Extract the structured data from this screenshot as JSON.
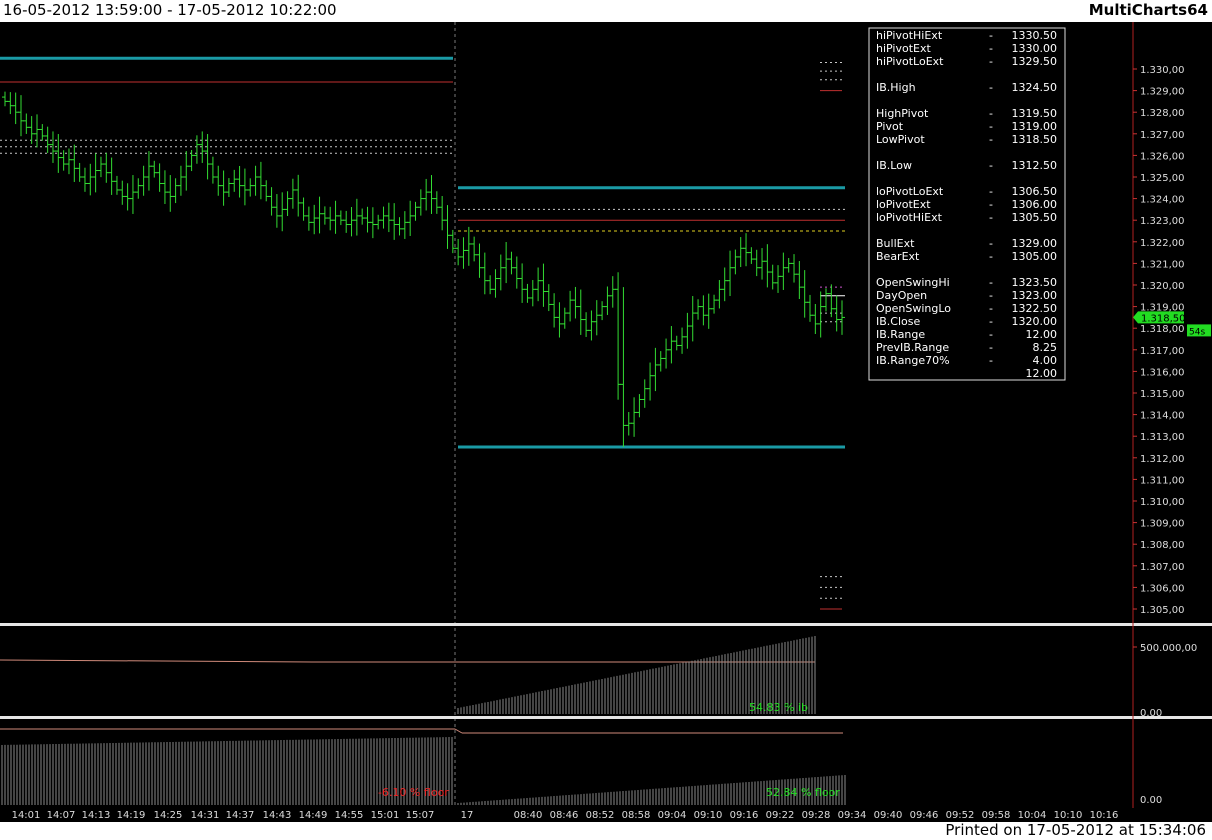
{
  "window": {
    "title_range": "16-05-2012 13:59:00 - 17-05-2012 10:22:00",
    "app_name": "MultiCharts64",
    "printed_on": "Printed on 17-05-2012 at 15:34:06"
  },
  "colors": {
    "background": "#000000",
    "bars": "#33dd33",
    "teal_levels": "#1a9aa5",
    "dashed_pivot": "#c8c8c8",
    "red_lines": "#c03030",
    "yellow_lines": "#e0d020",
    "volume_bars": "#8a8a8a",
    "axis_line": "#b02020",
    "last_price_tag": "#22dd22",
    "text_green": "#22dd22",
    "text_red": "#ee2222"
  },
  "chart_data": {
    "type": "bar",
    "title": "",
    "x_ticks": [
      "14:01",
      "14:07",
      "14:13",
      "14:19",
      "14:25",
      "14:31",
      "14:37",
      "14:43",
      "14:49",
      "14:55",
      "15:01",
      "15:07",
      "17",
      "08:40",
      "08:46",
      "08:52",
      "08:58",
      "09:04",
      "09:10",
      "09:16",
      "09:22",
      "09:28",
      "09:34",
      "09:40",
      "09:46",
      "09:52",
      "09:58",
      "10:04",
      "10:10",
      "10:16"
    ],
    "y_ticks": [
      "1.330,00",
      "1.329,00",
      "1.328,00",
      "1.327,00",
      "1.326,00",
      "1.325,00",
      "1.324,00",
      "1.323,00",
      "1.322,00",
      "1.321,00",
      "1.320,00",
      "1.319,00",
      "1.318,00",
      "1.317,00",
      "1.316,00",
      "1.315,00",
      "1.314,00",
      "1.313,00",
      "1.312,00",
      "1.311,00",
      "1.310,00",
      "1.309,00",
      "1.308,00",
      "1.307,00",
      "1.306,00",
      "1.305,00"
    ],
    "ylim": [
      1304.6,
      1330.8
    ],
    "close_path": [
      1328.5,
      1328.3,
      1328.0,
      1327.6,
      1327.3,
      1327.0,
      1327.2,
      1326.9,
      1326.5,
      1326.2,
      1325.9,
      1325.6,
      1325.8,
      1325.4,
      1325.0,
      1324.7,
      1325.0,
      1325.3,
      1325.6,
      1325.2,
      1324.8,
      1324.4,
      1324.1,
      1324.0,
      1324.3,
      1324.6,
      1325.0,
      1325.5,
      1325.2,
      1324.7,
      1324.3,
      1324.1,
      1324.6,
      1325.0,
      1325.5,
      1326.0,
      1326.5,
      1326.2,
      1325.6,
      1325.0,
      1324.6,
      1324.3,
      1324.7,
      1324.9,
      1324.6,
      1324.4,
      1324.6,
      1325.0,
      1324.6,
      1324.1,
      1323.6,
      1323.2,
      1323.5,
      1324.0,
      1324.4,
      1323.8,
      1323.2,
      1322.9,
      1323.1,
      1323.3,
      1323.1,
      1323.0,
      1323.2,
      1323.0,
      1322.8,
      1323.0,
      1323.2,
      1323.1,
      1322.9,
      1322.8,
      1323.0,
      1323.2,
      1323.0,
      1322.8,
      1322.6,
      1322.9,
      1323.2,
      1323.6,
      1324.0,
      1324.3,
      1324.0,
      1323.6,
      1323.0,
      1322.3,
      1321.7,
      1321.3,
      1321.6,
      1321.9,
      1321.4,
      1320.8,
      1320.2,
      1319.8,
      1320.3,
      1320.8,
      1321.2,
      1320.8,
      1320.3,
      1319.8,
      1319.4,
      1319.8,
      1320.2,
      1319.7,
      1319.1,
      1318.5,
      1318.2,
      1318.7,
      1319.3,
      1319.0,
      1318.4,
      1317.9,
      1318.3,
      1318.6,
      1319.0,
      1319.5,
      1319.8,
      1315.4,
      1313.5,
      1313.6,
      1314.1,
      1314.7,
      1315.2,
      1315.8,
      1316.3,
      1316.6,
      1317.0,
      1317.4,
      1317.2,
      1317.6,
      1318.1,
      1318.7,
      1319.0,
      1318.6,
      1318.9,
      1319.3,
      1319.8,
      1320.2,
      1320.8,
      1321.3,
      1321.7,
      1321.5,
      1321.2,
      1320.8,
      1321.1,
      1320.6,
      1320.1,
      1320.4,
      1320.8,
      1321.0,
      1320.5,
      1319.9,
      1319.2,
      1318.6,
      1318.2,
      1319.0,
      1319.6,
      1318.9,
      1318.4,
      1318.5
    ]
  },
  "reference_lines": [
    {
      "name": "hiPivotHiExt",
      "value": 1330.5
    },
    {
      "name": "IB.High prev",
      "value": 1329.4
    },
    {
      "name": "pivot-high-prev",
      "value": 1326.7
    },
    {
      "name": "pivot-prev",
      "value": 1326.4
    },
    {
      "name": "pivot-low-prev",
      "value": 1326.1
    },
    {
      "name": "IB.High",
      "value": 1324.5
    },
    {
      "name": "IB.Low",
      "value": 1312.5
    },
    {
      "name": "OpenSwingHi",
      "value": 1323.5
    },
    {
      "name": "DayOpen",
      "value": 1323.0
    },
    {
      "name": "OpenSwingLo",
      "value": 1322.5
    }
  ],
  "stats_table": [
    {
      "label": "hiPivotHiExt",
      "sep": "-",
      "value": "1330.50"
    },
    {
      "label": "hiPivotExt",
      "sep": "-",
      "value": "1330.00"
    },
    {
      "label": "hiPivotLoExt",
      "sep": "-",
      "value": "1329.50"
    },
    {
      "label": "",
      "sep": "",
      "value": ""
    },
    {
      "label": "IB.High",
      "sep": "-",
      "value": "1324.50"
    },
    {
      "label": "",
      "sep": "",
      "value": ""
    },
    {
      "label": "HighPivot",
      "sep": "-",
      "value": "1319.50"
    },
    {
      "label": "Pivot",
      "sep": "-",
      "value": "1319.00"
    },
    {
      "label": "LowPivot",
      "sep": "-",
      "value": "1318.50"
    },
    {
      "label": "",
      "sep": "",
      "value": ""
    },
    {
      "label": "IB.Low",
      "sep": "-",
      "value": "1312.50"
    },
    {
      "label": "",
      "sep": "",
      "value": ""
    },
    {
      "label": "loPivotLoExt",
      "sep": "-",
      "value": "1306.50"
    },
    {
      "label": "loPivotExt",
      "sep": "-",
      "value": "1306.00"
    },
    {
      "label": "loPivotHiExt",
      "sep": "-",
      "value": "1305.50"
    },
    {
      "label": "",
      "sep": "",
      "value": ""
    },
    {
      "label": "BullExt",
      "sep": "-",
      "value": "1329.00"
    },
    {
      "label": "BearExt",
      "sep": "-",
      "value": "1305.00"
    },
    {
      "label": "",
      "sep": "",
      "value": ""
    },
    {
      "label": "OpenSwingHi",
      "sep": "-",
      "value": "1323.50"
    },
    {
      "label": "DayOpen",
      "sep": "-",
      "value": "1323.00"
    },
    {
      "label": "OpenSwingLo",
      "sep": "-",
      "value": "1322.50"
    },
    {
      "label": "IB.Close",
      "sep": "-",
      "value": "1320.00"
    },
    {
      "label": "IB.Range",
      "sep": "-",
      "value": "12.00"
    },
    {
      "label": "PrevIB.Range",
      "sep": "-",
      "value": "8.25"
    },
    {
      "label": "IB.Range70%",
      "sep": "-",
      "value": "4.00"
    },
    {
      "label": "",
      "sep": "",
      "value": "12.00"
    }
  ],
  "price_tag": {
    "last_price": "1.318,50",
    "countdown": "54s"
  },
  "sub_pane1": {
    "axis_ticks": [
      "500.000,00",
      "0.00"
    ],
    "label": "54.83 %  ib"
  },
  "sub_pane2": {
    "axis_ticks": [
      "0.00"
    ],
    "label_left": "-6.10 %  floor",
    "label_right": "52.84 %  floor"
  }
}
